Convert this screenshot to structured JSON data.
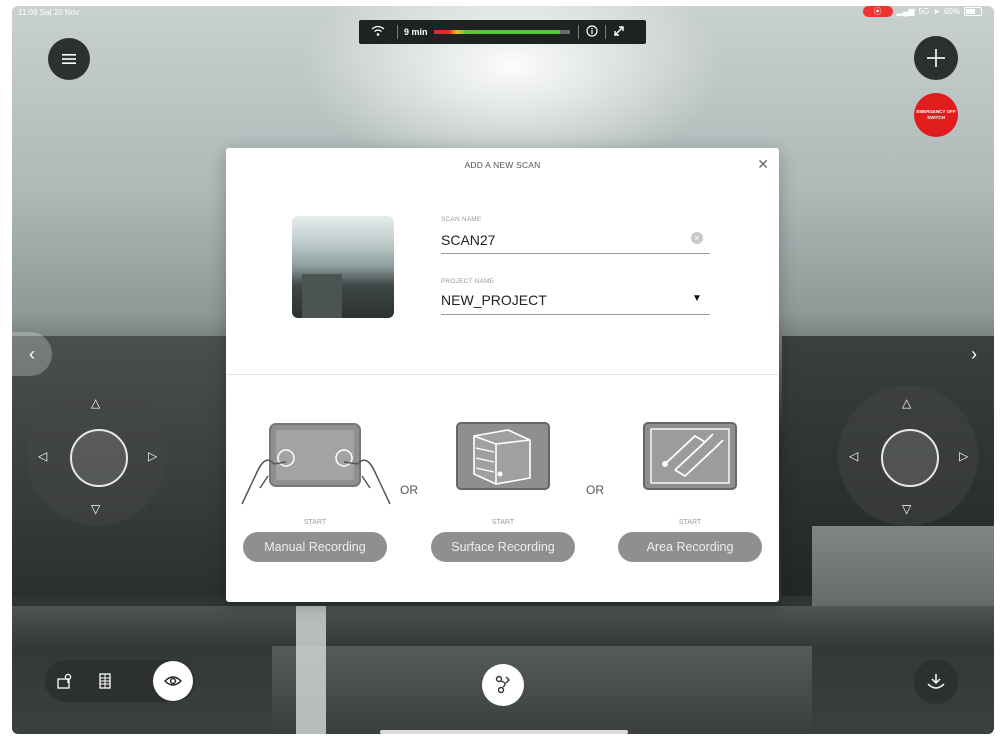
{
  "status_bar": {
    "time_date": "11:09  Sat 20 Nov",
    "signal": "5G",
    "battery": "60%"
  },
  "top_bar": {
    "duration": "9 min",
    "battery_level": 0.93
  },
  "emergency": {
    "label": "EMERGENCY OFF SWITCH"
  },
  "modal": {
    "title": "ADD A NEW SCAN",
    "scan_name_label": "SCAN NAME",
    "scan_name_value": "SCAN27",
    "project_name_label": "PROJECT NAME",
    "project_name_value": "NEW_PROJECT",
    "or_text": "OR",
    "start_label": "START",
    "modes": [
      {
        "label": "Manual Recording",
        "icon": "tablet-hands-icon"
      },
      {
        "label": "Surface Recording",
        "icon": "surface-scan-icon"
      },
      {
        "label": "Area Recording",
        "icon": "area-scan-icon"
      }
    ]
  },
  "icons": {
    "menu": "menu-icon",
    "add": "plus-icon",
    "close": "close-icon",
    "wifi": "wifi-icon",
    "info": "info-icon",
    "expand": "expand-icon",
    "map": "map-pin-icon",
    "building": "building-icon",
    "view": "eye-icon",
    "path": "path-icon",
    "download": "download-rotate-icon"
  },
  "colors": {
    "accent_red": "#e21d1d",
    "button_gray": "#8f8f8f",
    "dark_button": "#2c3030"
  }
}
